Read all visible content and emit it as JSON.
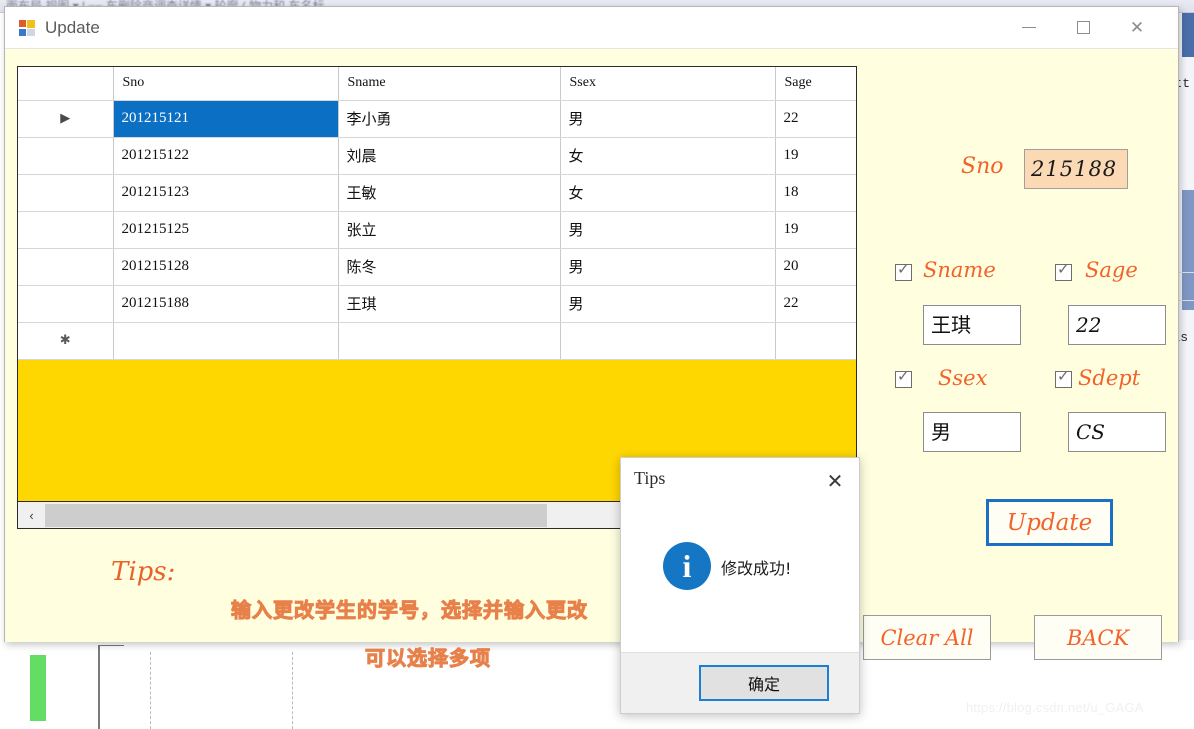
{
  "background": {
    "toolbar_text": "面布局  视图     ▾   | ⌐⌐ 车删除商调查详情  ▾ 轮廓   ( 物力和 车名标",
    "code_fragment_1": "utt",
    "code_fragment_2": "is",
    "watermark": "https://blog.csdn.net/u_GAGA"
  },
  "window": {
    "title": "Update",
    "icon": "app-window-icon",
    "minimize_glyph": "minimize-icon",
    "maximize_glyph": "maximize-icon",
    "close_glyph": "✕"
  },
  "grid": {
    "columns": [
      "",
      "Sno",
      "Sname",
      "Ssex",
      "Sage"
    ],
    "rows": [
      {
        "marker": "▶",
        "selected": true,
        "sno": "201215121",
        "sname": "李小勇",
        "ssex": "男",
        "sage": "22"
      },
      {
        "marker": "",
        "selected": false,
        "sno": "201215122",
        "sname": "刘晨",
        "ssex": "女",
        "sage": "19"
      },
      {
        "marker": "",
        "selected": false,
        "sno": "201215123",
        "sname": "王敏",
        "ssex": "女",
        "sage": "18"
      },
      {
        "marker": "",
        "selected": false,
        "sno": "201215125",
        "sname": "张立",
        "ssex": "男",
        "sage": "19"
      },
      {
        "marker": "",
        "selected": false,
        "sno": "201215128",
        "sname": "陈冬",
        "ssex": "男",
        "sage": "20"
      },
      {
        "marker": "",
        "selected": false,
        "sno": "201215188",
        "sname": "王琪",
        "ssex": "男",
        "sage": "22"
      },
      {
        "marker": "✱",
        "selected": false,
        "sno": "",
        "sname": "",
        "ssex": "",
        "sage": ""
      }
    ],
    "empty_area_color": "#ffd700",
    "selection_color": "#0b6fc4",
    "scroll_left_arrow": "‹"
  },
  "form": {
    "sno_label": "Sno",
    "sno_value": "215188",
    "fields": [
      {
        "key": "sname",
        "label": "Sname",
        "checked": true,
        "value": "王琪"
      },
      {
        "key": "sage",
        "label": "Sage",
        "checked": true,
        "value": "22"
      },
      {
        "key": "ssex",
        "label": "Ssex",
        "checked": true,
        "value": "男"
      },
      {
        "key": "sdept",
        "label": "Sdept",
        "checked": true,
        "value": "CS"
      }
    ],
    "update_button": "Update",
    "clear_all_button": "Clear All",
    "back_button": "BACK",
    "accent_color": "#f2622a",
    "focus_border_color": "#1b6fc4"
  },
  "tips": {
    "heading": "Tips:",
    "line1": "输入更改学生的学号，选择并输入更改",
    "line2": "可以选择多项"
  },
  "dialog": {
    "title": "Tips",
    "close_glyph": "✕",
    "icon": "information-icon",
    "icon_glyph": "i",
    "message": "修改成功!",
    "ok_button": "确定",
    "icon_color": "#1577c4"
  }
}
